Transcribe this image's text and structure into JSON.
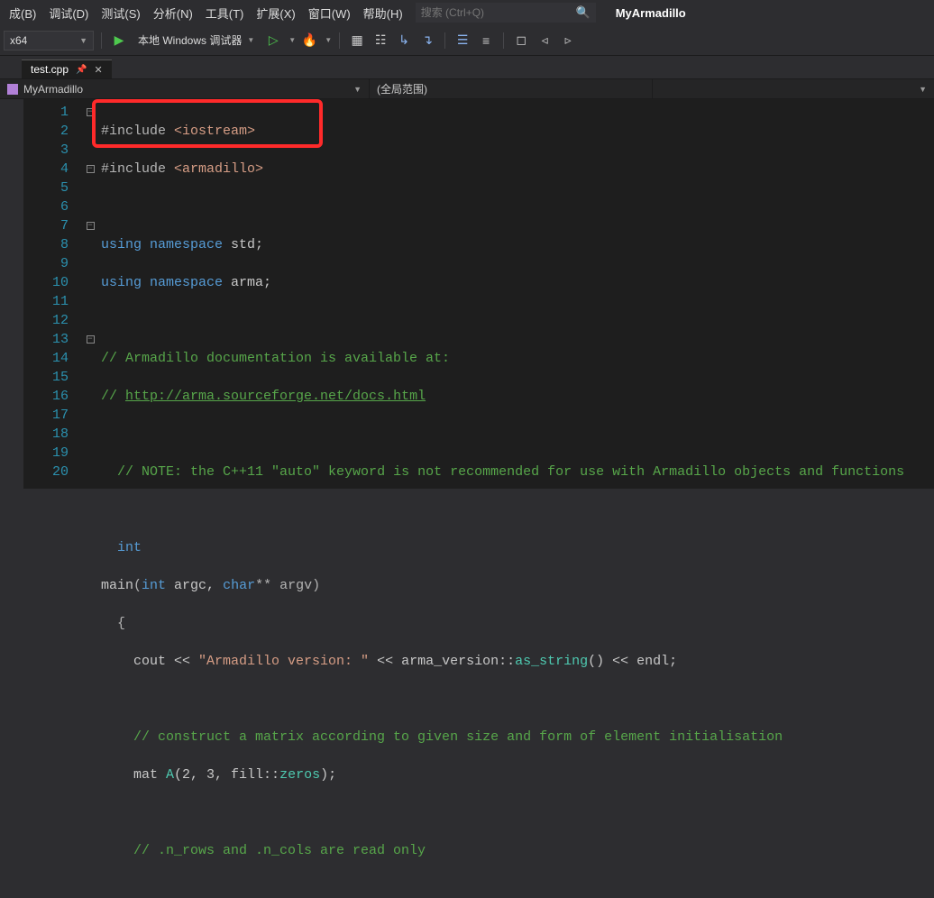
{
  "menu": [
    "成(B)",
    "调试(D)",
    "测试(S)",
    "分析(N)",
    "工具(T)",
    "扩展(X)",
    "窗口(W)",
    "帮助(H)"
  ],
  "search": {
    "placeholder": "搜索 (Ctrl+Q)"
  },
  "solution_name": "MyArmadillo",
  "platform": "x64",
  "start_label": "本地 Windows 调试器",
  "tab": {
    "name": "test.cpp"
  },
  "nav": {
    "project": "MyArmadillo",
    "scope": "(全局范围)"
  },
  "code": {
    "lines": [
      1,
      2,
      3,
      4,
      5,
      6,
      7,
      8,
      9,
      10,
      11,
      12,
      13,
      14,
      15,
      16,
      17,
      18,
      19,
      20
    ],
    "l1a": "#include ",
    "l1b": "<iostream>",
    "l2a": "#include ",
    "l2b": "<armadillo>",
    "l4a": "using",
    "l4b": " namespace",
    "l4c": " std;",
    "l5a": "using",
    "l5b": " namespace",
    "l5c": " arma;",
    "l7": "// Armadillo documentation is available at:",
    "l8a": "// ",
    "l8b": "http://arma.sourceforge.net/docs.html",
    "l10": "// NOTE: the C++11 \"auto\" keyword is not recommended for use with Armadillo objects and functions",
    "l12": "int",
    "l13a": "main",
    "l13b": "(",
    "l13c": "int",
    "l13d": " argc, ",
    "l13e": "char",
    "l13f": "** argv)",
    "l14": "  {",
    "l15a": "    cout << ",
    "l15b": "\"Armadillo version: \"",
    "l15c": " << arma_version::",
    "l15d": "as_string",
    "l15e": "() << endl;",
    "l17": "    // construct a matrix according to given size and form of element initialisation",
    "l18a": "    mat ",
    "l18b": "A",
    "l18c": "(2, 3, fill::",
    "l18d": "zeros",
    "l18e": ");",
    "l20": "    // .n_rows and .n_cols are read only"
  }
}
